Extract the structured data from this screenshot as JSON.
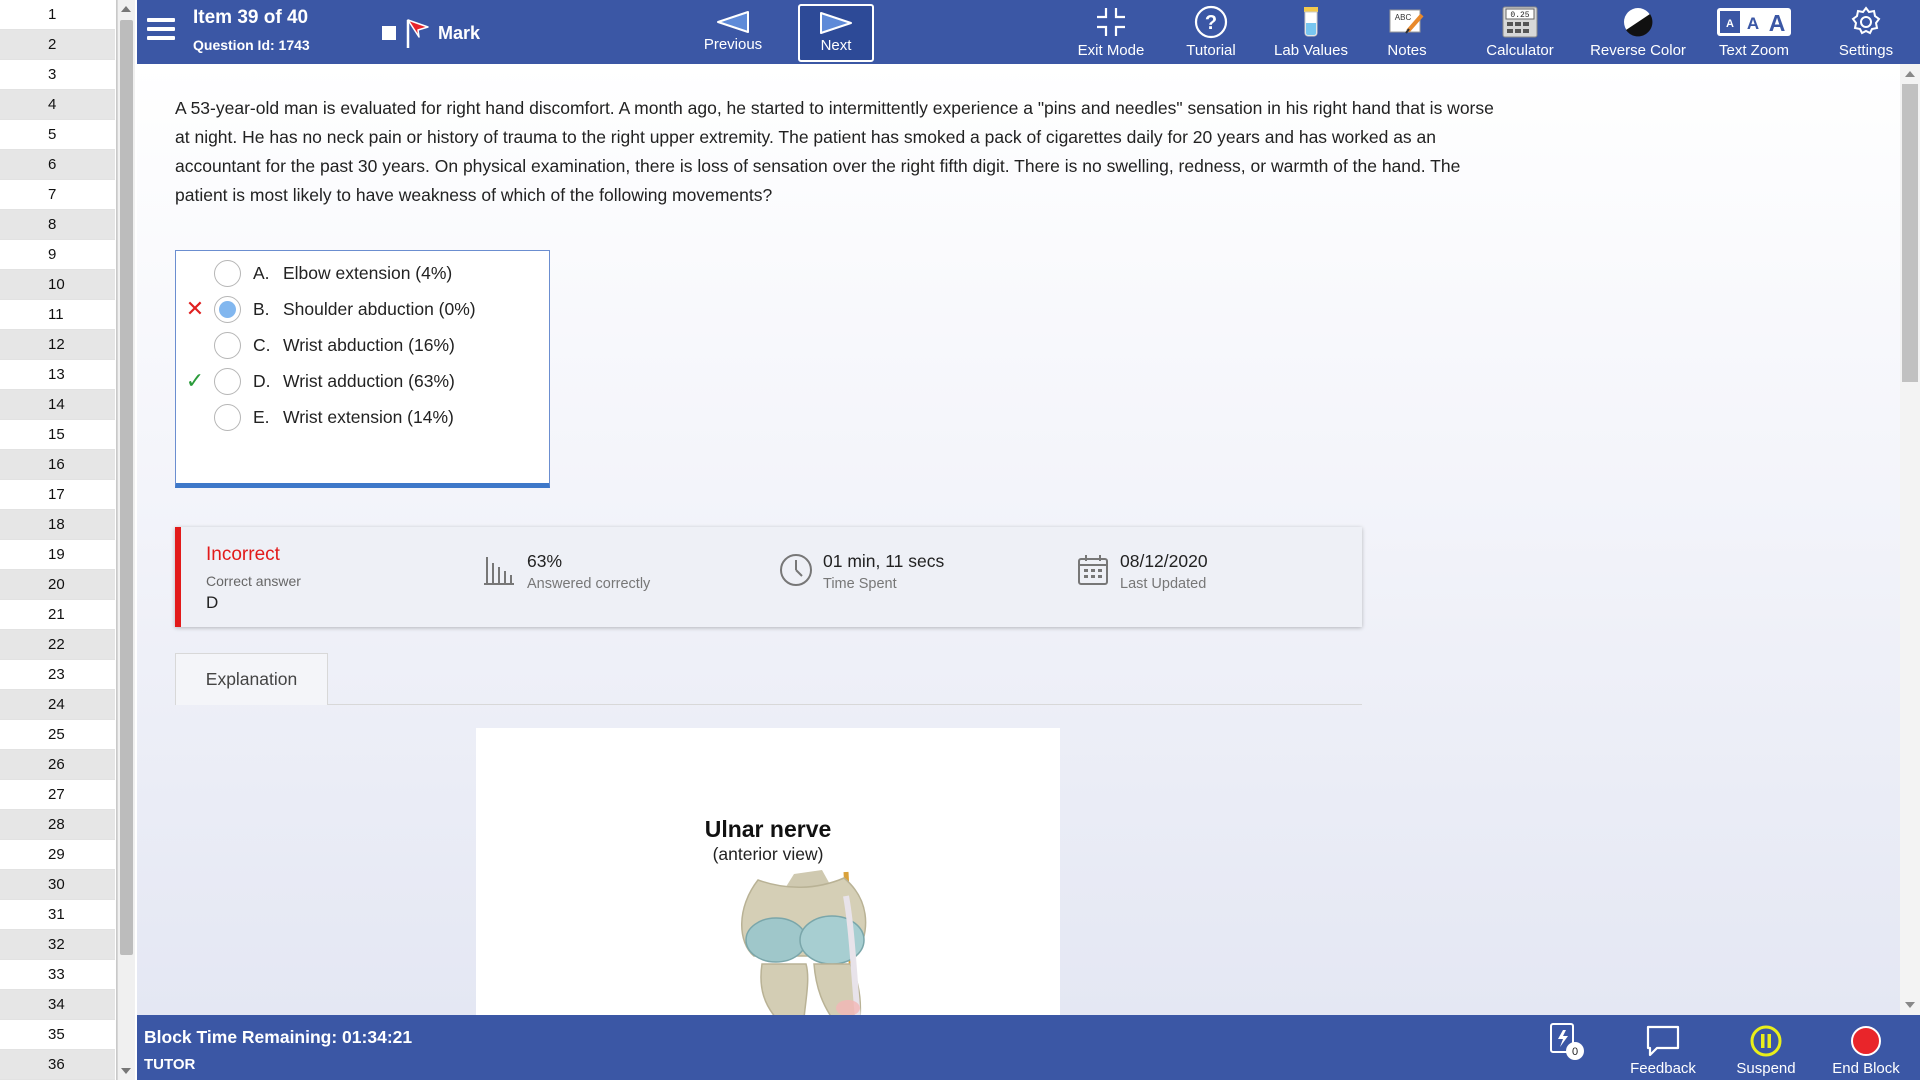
{
  "item_list": [
    "1",
    "2",
    "3",
    "4",
    "5",
    "6",
    "7",
    "8",
    "9",
    "10",
    "11",
    "12",
    "13",
    "14",
    "15",
    "16",
    "17",
    "18",
    "19",
    "20",
    "21",
    "22",
    "23",
    "24",
    "25",
    "26",
    "27",
    "28",
    "29",
    "30",
    "31",
    "32",
    "33",
    "34",
    "35",
    "36"
  ],
  "header": {
    "item_title": "Item 39 of 40",
    "question_id": "Question Id: 1743",
    "mark_label": "Mark",
    "previous_label": "Previous",
    "next_label": "Next",
    "tools": {
      "exit_mode": "Exit Mode",
      "tutorial": "Tutorial",
      "lab_values": "Lab Values",
      "notes": "Notes",
      "calculator": "Calculator",
      "calculator_display": "0.25",
      "reverse_color": "Reverse Color",
      "text_zoom": "Text Zoom",
      "settings": "Settings"
    }
  },
  "question": {
    "stem": "A 53-year-old man is evaluated for right hand discomfort.  A month ago, he started to intermittently experience a \"pins and needles\" sensation in his right hand that is worse at night.  He has no neck pain or history of trauma to the right upper extremity.  The patient has smoked a pack of cigarettes daily for 20 years and has worked as an accountant for the past 30 years.  On physical examination, there is loss of sensation over the right fifth digit.  There is no swelling, redness, or warmth of the hand.  The patient is most likely to have weakness of which of the following movements?",
    "choices": [
      {
        "letter": "A.",
        "text": "Elbow extension (4%)",
        "status": "",
        "selected": false
      },
      {
        "letter": "B.",
        "text": "Shoulder abduction (0%)",
        "status": "wrong",
        "selected": true
      },
      {
        "letter": "C.",
        "text": "Wrist abduction (16%)",
        "status": "",
        "selected": false
      },
      {
        "letter": "D.",
        "text": "Wrist adduction (63%)",
        "status": "correct",
        "selected": false
      },
      {
        "letter": "E.",
        "text": "Wrist extension (14%)",
        "status": "",
        "selected": false
      }
    ]
  },
  "result": {
    "status": "Incorrect",
    "correct_answer_label": "Correct answer",
    "correct_answer": "D",
    "percent_value": "63%",
    "percent_label": "Answered correctly",
    "time_value": "01 min, 11 secs",
    "time_label": "Time Spent",
    "date_value": "08/12/2020",
    "date_label": "Last Updated"
  },
  "explanation": {
    "tab_label": "Explanation",
    "figure_title": "Ulnar nerve",
    "figure_subtitle": "(anterior view)"
  },
  "footer": {
    "block_time": "Block Time Remaining: 01:34:21",
    "mode": "TUTOR",
    "flashcard_count": "0",
    "feedback": "Feedback",
    "suspend": "Suspend",
    "end_block": "End Block"
  },
  "colors": {
    "bar_blue": "#3b57a5",
    "incorrect_red": "#e21a1a",
    "correct_green": "#2a9b3a",
    "selected_radio": "#82b7ef"
  }
}
